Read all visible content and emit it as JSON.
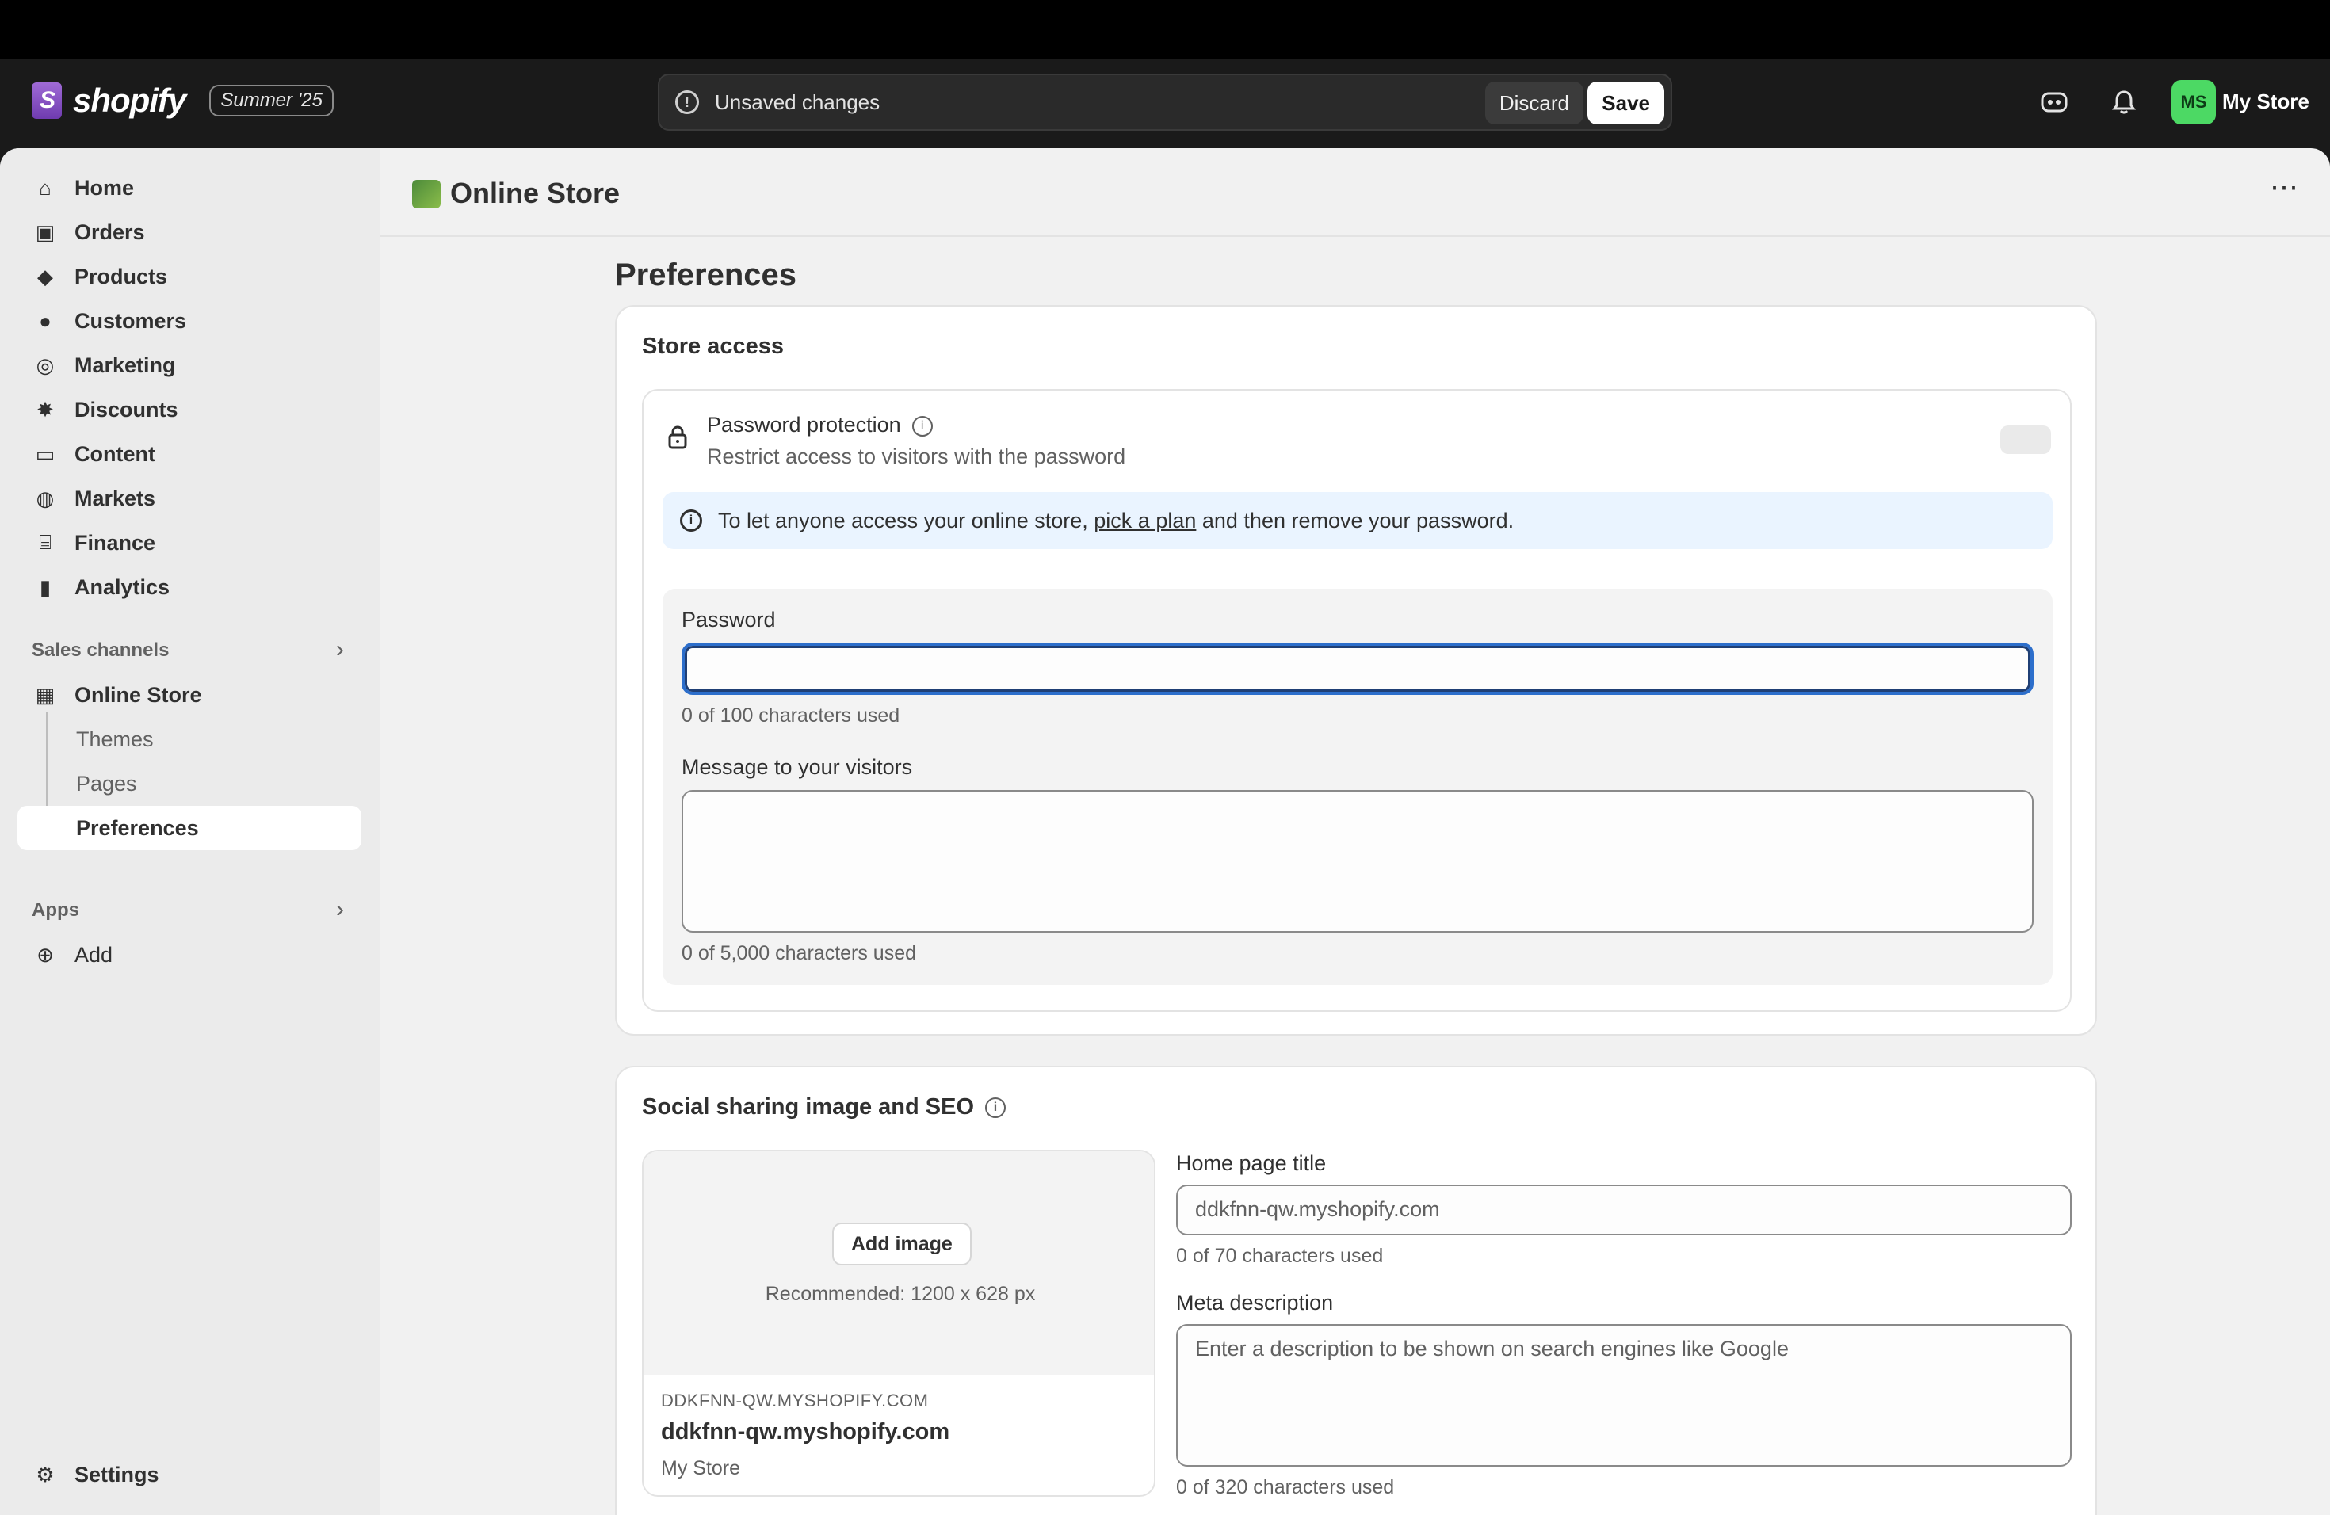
{
  "brand": {
    "name": "shopify",
    "edition": "Summer '25"
  },
  "save_bar": {
    "message": "Unsaved changes",
    "discard_label": "Discard",
    "save_label": "Save"
  },
  "header": {
    "avatar_initials": "MS",
    "store_name": "My Store"
  },
  "sidebar": {
    "items": [
      {
        "label": "Home",
        "icon": "home-icon"
      },
      {
        "label": "Orders",
        "icon": "inbox-icon"
      },
      {
        "label": "Products",
        "icon": "tag-icon"
      },
      {
        "label": "Customers",
        "icon": "person-icon"
      },
      {
        "label": "Marketing",
        "icon": "target-icon"
      },
      {
        "label": "Discounts",
        "icon": "discount-icon"
      },
      {
        "label": "Content",
        "icon": "image-icon"
      },
      {
        "label": "Markets",
        "icon": "globe-icon"
      },
      {
        "label": "Finance",
        "icon": "bank-icon"
      },
      {
        "label": "Analytics",
        "icon": "chart-icon"
      }
    ],
    "sales_channels_label": "Sales channels",
    "online_store_label": "Online Store",
    "sub_items": [
      "Themes",
      "Pages",
      "Preferences"
    ],
    "apps_label": "Apps",
    "add_label": "Add",
    "settings_label": "Settings"
  },
  "page": {
    "header_title": "Online Store",
    "title": "Preferences"
  },
  "store_access": {
    "title": "Store access",
    "password_protection_title": "Password protection",
    "password_protection_desc": "Restrict access to visitors with the password",
    "banner_prefix": "To let anyone access your online store, ",
    "banner_link": "pick a plan",
    "banner_suffix": " and then remove your password.",
    "password_label": "Password",
    "password_value": "",
    "password_help": "0 of 100 characters used",
    "message_label": "Message to your visitors",
    "message_value": "",
    "message_help": "0 of 5,000 characters used"
  },
  "seo": {
    "title": "Social sharing image and SEO",
    "add_image_label": "Add image",
    "recommended": "Recommended: 1200 x 628 px",
    "preview_url": "DDKFNN-QW.MYSHOPIFY.COM",
    "preview_title": "ddkfnn-qw.myshopify.com",
    "preview_store": "My Store",
    "home_title_label": "Home page title",
    "home_title_placeholder": "ddkfnn-qw.myshopify.com",
    "home_title_help": "0 of 70 characters used",
    "meta_label": "Meta description",
    "meta_placeholder": "Enter a description to be shown on search engines like Google",
    "meta_help": "0 of 320 characters used"
  }
}
